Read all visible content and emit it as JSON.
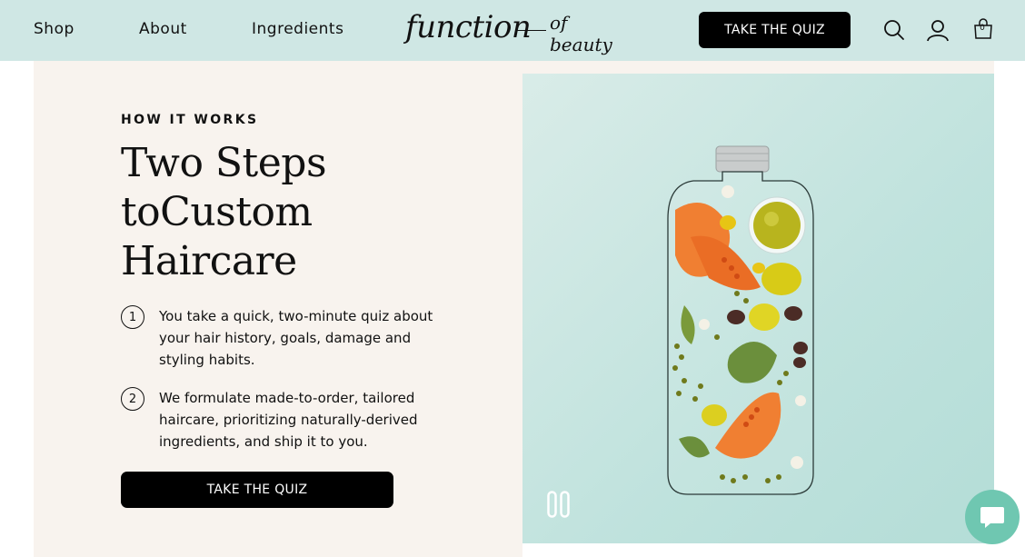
{
  "nav": {
    "shop": "Shop",
    "about": "About",
    "ingredients": "Ingredients"
  },
  "logo": {
    "main": "function",
    "sub": "of beauty"
  },
  "header": {
    "quiz_label": "TAKE THE QUIZ",
    "cart_count": "0"
  },
  "hero": {
    "eyebrow": "HOW IT WORKS",
    "headline_lines": [
      "Two Steps",
      "toCustom",
      "Haircare"
    ],
    "steps": [
      {
        "number": "1",
        "lines": [
          "You take a quick, two-minute quiz about",
          "your hair history, goals, damage and",
          "styling habits."
        ]
      },
      {
        "number": "2",
        "lines": [
          "We formulate made-to-order, tailored",
          "haircare, prioritizing naturally-derived",
          "ingredients, and ship it to you."
        ]
      }
    ],
    "quiz_label": "TAKE THE QUIZ"
  },
  "icons": {
    "search": "search-icon",
    "account": "user-icon",
    "cart": "cart-icon",
    "pause": "pause-icon",
    "chat": "chat-icon"
  },
  "colors": {
    "header_bg": "#cfe7e4",
    "hero_bg": "#f8f3ee",
    "image_bg": "#bfe2dd",
    "button_bg": "#000000",
    "chat_bg": "#6fc7b1"
  }
}
